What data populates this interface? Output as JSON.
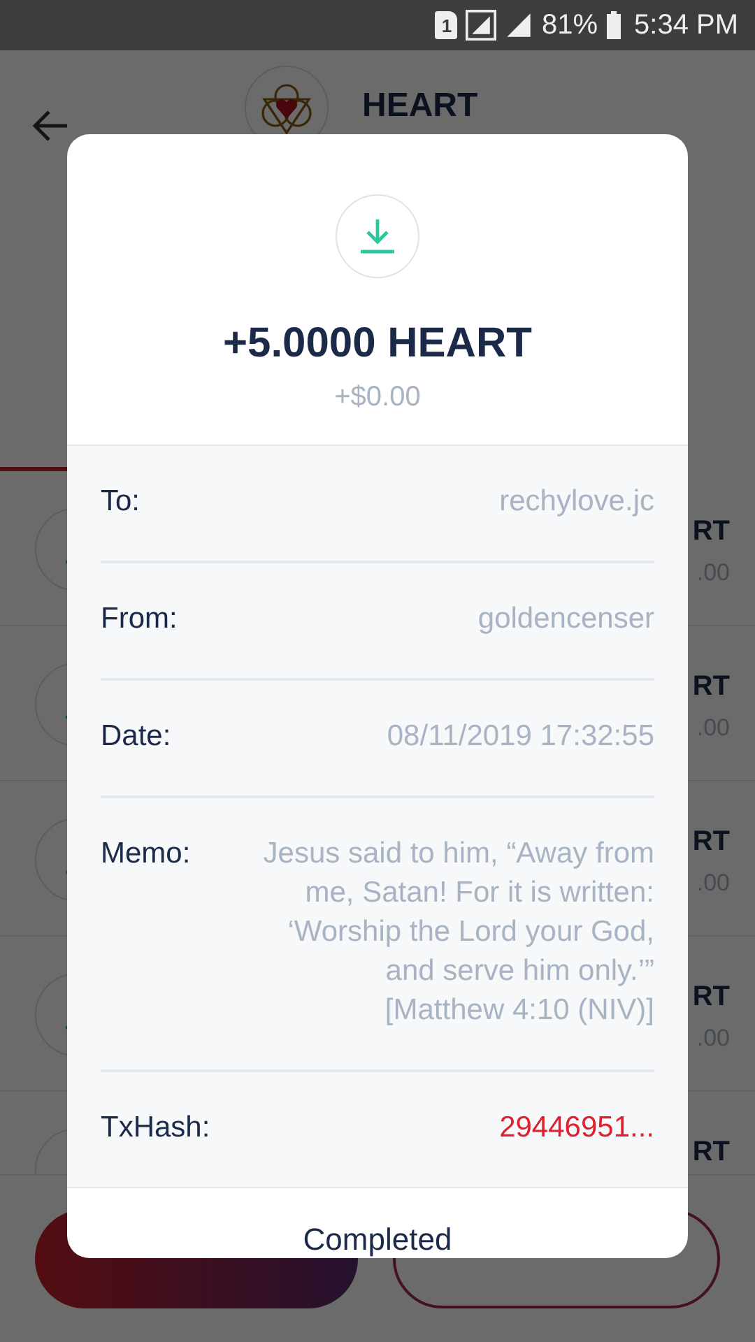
{
  "status_bar": {
    "sim_slot": "1",
    "battery": "81%",
    "time": "5:34 PM"
  },
  "header": {
    "title": "HEART"
  },
  "transactions": [
    {
      "kind": "receive",
      "amount": "RT",
      "fiat": ".00"
    },
    {
      "kind": "receive",
      "amount": "RT",
      "fiat": ".00"
    },
    {
      "kind": "send",
      "amount": "RT",
      "fiat": ".00"
    },
    {
      "kind": "receive",
      "amount": "RT",
      "fiat": ".00"
    },
    {
      "amount": "RT"
    }
  ],
  "actions": [
    {
      "kind": "send"
    },
    {
      "kind": "receive"
    }
  ],
  "dialog": {
    "kind": "receive",
    "amount": "+5.0000 HEART",
    "fiat": "+$0.00",
    "details": [
      {
        "label": "To:",
        "value": "rechylove.jc",
        "kind": "plain"
      },
      {
        "label": "From:",
        "value": "goldencenser",
        "kind": "plain"
      },
      {
        "label": "Date:",
        "value": "08/11/2019 17:32:55",
        "kind": "plain"
      },
      {
        "label": "Memo:",
        "value": "Jesus said to him, “Away from me, Satan! For it is written: ‘Worship the Lord your God, and serve him only.’” [Matthew 4:10 (NIV)]",
        "kind": "plain"
      },
      {
        "label": "TxHash:",
        "value": "29446951...",
        "kind": "link"
      }
    ],
    "status": "Completed"
  }
}
